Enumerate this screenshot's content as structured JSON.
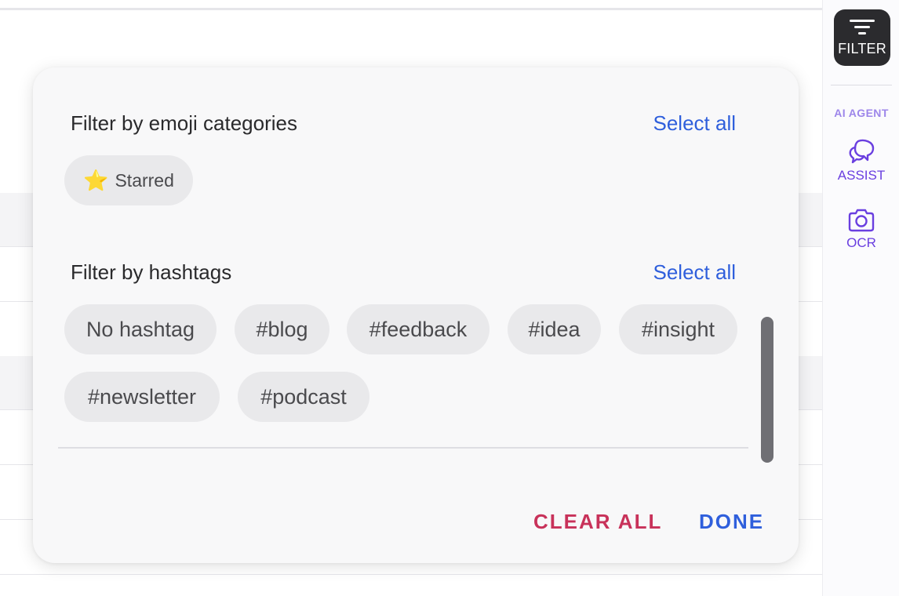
{
  "rail": {
    "filter_label": "FILTER",
    "ai_agent_heading": "AI AGENT",
    "assist_label": "ASSIST",
    "ocr_label": "OCR"
  },
  "panel": {
    "emoji_section": {
      "title": "Filter by emoji categories",
      "select_all": "Select all",
      "chips": [
        {
          "emoji": "star-icon",
          "label": "Starred"
        }
      ]
    },
    "hashtag_section": {
      "title": "Filter by hashtags",
      "select_all": "Select all",
      "chips": [
        {
          "label": "No hashtag"
        },
        {
          "label": "#blog"
        },
        {
          "label": "#feedback"
        },
        {
          "label": "#idea"
        },
        {
          "label": "#insight"
        },
        {
          "label": "#newsletter"
        },
        {
          "label": "#podcast"
        }
      ]
    },
    "clear_all": "CLEAR ALL",
    "done": "DONE"
  },
  "colors": {
    "accent_blue": "#2f5fdc",
    "clear_red": "#c8325a",
    "ai_purple": "#6a3fe0",
    "filter_button_bg": "#2b2b2e"
  }
}
